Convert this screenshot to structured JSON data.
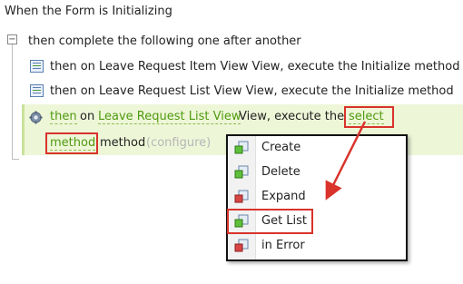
{
  "heading": "When the Form is Initializing",
  "group": {
    "toggle": "−",
    "label": "then complete the following one after another"
  },
  "rules": [
    {
      "text": "then on Leave Request Item View View, execute the Initialize method"
    },
    {
      "text": "then on Leave Request List View View, execute the Initialize method"
    }
  ],
  "selected_rule": {
    "then": "then",
    "on": "on",
    "view_link": "Leave Request List View",
    "view_suffix": "View, execute the",
    "method_link_line1": "select",
    "method_link_line2": "method",
    "method_word": "method",
    "configure": "(configure)"
  },
  "menu": {
    "items": [
      {
        "label": "Create",
        "icon": "create-icon"
      },
      {
        "label": "Delete",
        "icon": "delete-icon"
      },
      {
        "label": "Expand",
        "icon": "expand-icon"
      },
      {
        "label": "Get List",
        "icon": "get-list-icon"
      },
      {
        "label": "in Error",
        "icon": "in-error-icon"
      }
    ]
  },
  "colors": {
    "highlight": "#d9332b",
    "link": "#4f9a10",
    "selected_row_bg": "#eef6d8"
  }
}
